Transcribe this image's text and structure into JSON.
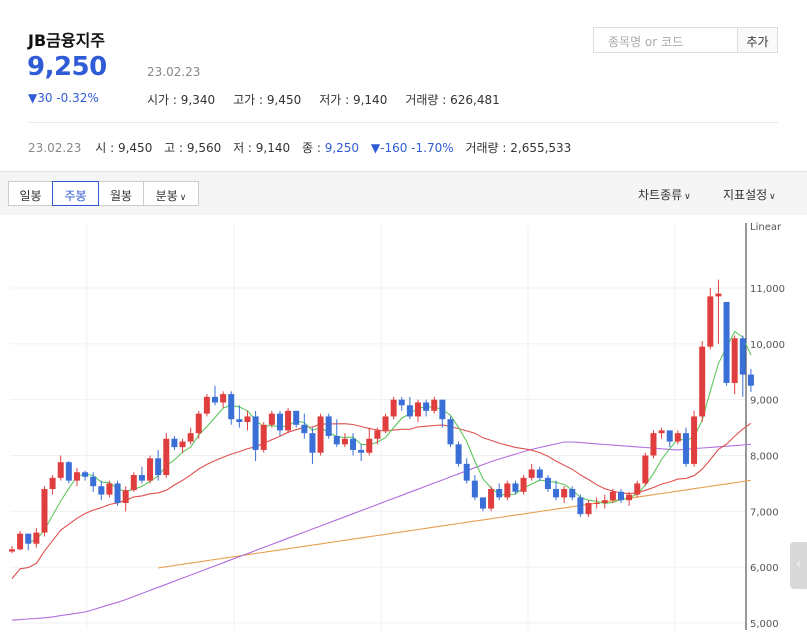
{
  "stock": {
    "name": "JB금융지주",
    "price": "9,250",
    "date": "23.02.23",
    "change": "▼30 -0.32%",
    "open_label": "시가 : 9,340",
    "high_label": "고가 : 9,450",
    "low_label": "저가 : 9,140",
    "volume_label": "거래량 : 626,481"
  },
  "search": {
    "placeholder": "종목명 or 코드",
    "add_label": "추가"
  },
  "summary": {
    "date": "23.02.23",
    "open": "시 : 9,450",
    "high": "고 : 9,560",
    "low": "저 : 9,140",
    "close_label": "종 : ",
    "close_value": "9,250",
    "change": "▼-160 -1.70%",
    "volume": "거래량 : 2,655,533"
  },
  "toolbar": {
    "tabs": [
      "일봉",
      "주봉",
      "월봉",
      "분봉"
    ],
    "active_tab": "주봉",
    "chart_type_label": "차트종류",
    "indicator_label": "지표설정"
  },
  "colors": {
    "up": "#e03e3e",
    "down": "#3a6fd8",
    "ma5": "#5fc85f",
    "ma20": "#e05050",
    "ma60": "#b070e0",
    "ma120": "#e8a050",
    "accent": "#2f5bd6"
  },
  "chart_data": {
    "type": "candlestick",
    "scale_label": "Linear",
    "yticks": [
      "5,000",
      "6,000",
      "7,000",
      "8,000",
      "9,000",
      "10,000",
      "11,000"
    ],
    "ylim": [
      5000,
      11600
    ],
    "candles": [
      [
        6280,
        6380,
        6250,
        6320
      ],
      [
        6320,
        6650,
        6300,
        6600
      ],
      [
        6600,
        6600,
        6300,
        6420
      ],
      [
        6420,
        6700,
        6350,
        6620
      ],
      [
        6620,
        7450,
        6550,
        7400
      ],
      [
        7400,
        7650,
        7300,
        7600
      ],
      [
        7600,
        8000,
        7550,
        7880
      ],
      [
        7880,
        7900,
        7500,
        7550
      ],
      [
        7550,
        7780,
        7450,
        7700
      ],
      [
        7700,
        7730,
        7550,
        7620
      ],
      [
        7620,
        7700,
        7350,
        7450
      ],
      [
        7450,
        7550,
        7200,
        7300
      ],
      [
        7300,
        7550,
        7250,
        7500
      ],
      [
        7500,
        7550,
        7100,
        7150
      ],
      [
        7150,
        7450,
        7000,
        7380
      ],
      [
        7380,
        7700,
        7350,
        7650
      ],
      [
        7650,
        7800,
        7500,
        7550
      ],
      [
        7550,
        8000,
        7500,
        7950
      ],
      [
        7950,
        8100,
        7550,
        7650
      ],
      [
        7650,
        8400,
        7600,
        8300
      ],
      [
        8300,
        8350,
        8100,
        8150
      ],
      [
        8150,
        8300,
        8050,
        8250
      ],
      [
        8250,
        8500,
        8200,
        8400
      ],
      [
        8400,
        8800,
        8300,
        8750
      ],
      [
        8750,
        9100,
        8700,
        9050
      ],
      [
        9050,
        9250,
        8900,
        8950
      ],
      [
        8950,
        9150,
        8850,
        9100
      ],
      [
        9100,
        9150,
        8550,
        8650
      ],
      [
        8650,
        8900,
        8500,
        8600
      ],
      [
        8600,
        8800,
        8450,
        8700
      ],
      [
        8700,
        8800,
        7900,
        8100
      ],
      [
        8100,
        8600,
        8050,
        8550
      ],
      [
        8550,
        8800,
        8500,
        8750
      ],
      [
        8750,
        8800,
        8350,
        8450
      ],
      [
        8450,
        8850,
        8400,
        8800
      ],
      [
        8800,
        8800,
        8500,
        8550
      ],
      [
        8550,
        8750,
        8300,
        8400
      ],
      [
        8400,
        8500,
        7850,
        8050
      ],
      [
        8050,
        8750,
        8000,
        8700
      ],
      [
        8700,
        8750,
        8300,
        8350
      ],
      [
        8350,
        8650,
        8150,
        8200
      ],
      [
        8200,
        8400,
        8150,
        8300
      ],
      [
        8300,
        8400,
        8000,
        8100
      ],
      [
        8100,
        8200,
        7900,
        8050
      ],
      [
        8050,
        8500,
        8000,
        8300
      ],
      [
        8300,
        8500,
        8200,
        8450
      ],
      [
        8450,
        8750,
        8400,
        8700
      ],
      [
        8700,
        9050,
        8650,
        9000
      ],
      [
        9000,
        9050,
        8800,
        8900
      ],
      [
        8900,
        9050,
        8650,
        8700
      ],
      [
        8700,
        9000,
        8600,
        8950
      ],
      [
        8950,
        9000,
        8700,
        8800
      ],
      [
        8800,
        9050,
        8750,
        9000
      ],
      [
        9000,
        9000,
        8500,
        8650
      ],
      [
        8650,
        8700,
        8150,
        8200
      ],
      [
        8200,
        8250,
        7800,
        7850
      ],
      [
        7850,
        7950,
        7500,
        7550
      ],
      [
        7550,
        7650,
        7200,
        7250
      ],
      [
        7250,
        7250,
        7000,
        7050
      ],
      [
        7050,
        7450,
        7000,
        7400
      ],
      [
        7400,
        7500,
        7200,
        7250
      ],
      [
        7250,
        7550,
        7200,
        7500
      ],
      [
        7500,
        7550,
        7300,
        7350
      ],
      [
        7350,
        7650,
        7300,
        7600
      ],
      [
        7600,
        7850,
        7550,
        7750
      ],
      [
        7750,
        7800,
        7550,
        7600
      ],
      [
        7600,
        7650,
        7350,
        7400
      ],
      [
        7400,
        7550,
        7200,
        7250
      ],
      [
        7250,
        7450,
        7150,
        7400
      ],
      [
        7400,
        7450,
        7200,
        7250
      ],
      [
        7250,
        7300,
        6900,
        6950
      ],
      [
        6950,
        7200,
        6900,
        7150
      ],
      [
        7150,
        7250,
        7050,
        7150
      ],
      [
        7150,
        7300,
        7050,
        7200
      ],
      [
        7200,
        7400,
        7150,
        7350
      ],
      [
        7350,
        7400,
        7150,
        7200
      ],
      [
        7200,
        7350,
        7100,
        7300
      ],
      [
        7300,
        7550,
        7250,
        7500
      ],
      [
        7500,
        8050,
        7450,
        8000
      ],
      [
        8000,
        8450,
        7950,
        8400
      ],
      [
        8400,
        8500,
        8300,
        8450
      ],
      [
        8450,
        8450,
        8150,
        8250
      ],
      [
        8250,
        8450,
        8200,
        8400
      ],
      [
        8400,
        8500,
        7800,
        7850
      ],
      [
        7850,
        8800,
        7800,
        8700
      ],
      [
        8700,
        10050,
        8600,
        9950
      ],
      [
        9950,
        11000,
        9900,
        10850
      ],
      [
        10850,
        11150,
        10000,
        10900
      ],
      [
        10750,
        10750,
        9250,
        9300
      ],
      [
        9300,
        10150,
        9100,
        10100
      ],
      [
        10100,
        10150,
        9050,
        9450
      ],
      [
        9450,
        9550,
        9140,
        9250
      ]
    ]
  }
}
